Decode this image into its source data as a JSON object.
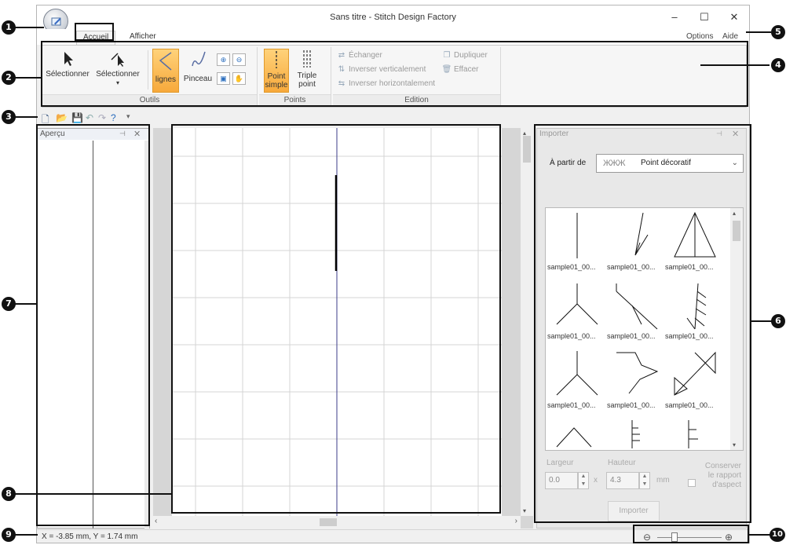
{
  "window": {
    "title": "Sans titre - Stitch Design Factory",
    "controls": {
      "minimize": "–",
      "maximize": "☐",
      "close": "✕"
    }
  },
  "tabs": [
    {
      "label": "Accueil",
      "active": true
    },
    {
      "label": "Afficher",
      "active": false
    }
  ],
  "menu_right": {
    "options": "Options",
    "help": "Aide"
  },
  "ribbon": {
    "outils": {
      "label": "Outils",
      "select1": "Sélectionner",
      "select2": "Sélectionner",
      "lines": "lignes",
      "brush": "Pinceau"
    },
    "points": {
      "label": "Points",
      "simple_1": "Point",
      "simple_2": "simple",
      "triple_1": "Triple",
      "triple_2": "point"
    },
    "edition": {
      "label": "Edition",
      "swap": "Échanger",
      "flip_v": "Inverser verticalement",
      "flip_h": "Inverser horizontalement",
      "duplicate": "Dupliquer",
      "delete": "Effacer"
    }
  },
  "preview": {
    "title": "Aperçu"
  },
  "importer": {
    "title": "Importer",
    "from_label": "À partir de",
    "from_value": "Point décoratif",
    "items": [
      "sample01_00...",
      "sample01_00...",
      "sample01_00...",
      "sample01_00...",
      "sample01_00...",
      "sample01_00...",
      "sample01_00...",
      "sample01_00...",
      "sample01_00..."
    ],
    "width_label": "Largeur",
    "height_label": "Hauteur",
    "width_value": "0.0",
    "height_value": "4.3",
    "times": "x",
    "unit": "mm",
    "keep_ratio_1": "Conserver",
    "keep_ratio_2": "le rapport",
    "keep_ratio_3": "d'aspect",
    "import_button": "Importer"
  },
  "status": {
    "coords": "X = -3.85 mm, Y = 1.74 mm"
  },
  "callouts": [
    "1",
    "2",
    "3",
    "4",
    "5",
    "6",
    "7",
    "8",
    "9",
    "10"
  ],
  "colors": {
    "accent_orange": "#f7a93b",
    "grid": "#d4d4d4",
    "center_line": "#3d3d8a"
  }
}
